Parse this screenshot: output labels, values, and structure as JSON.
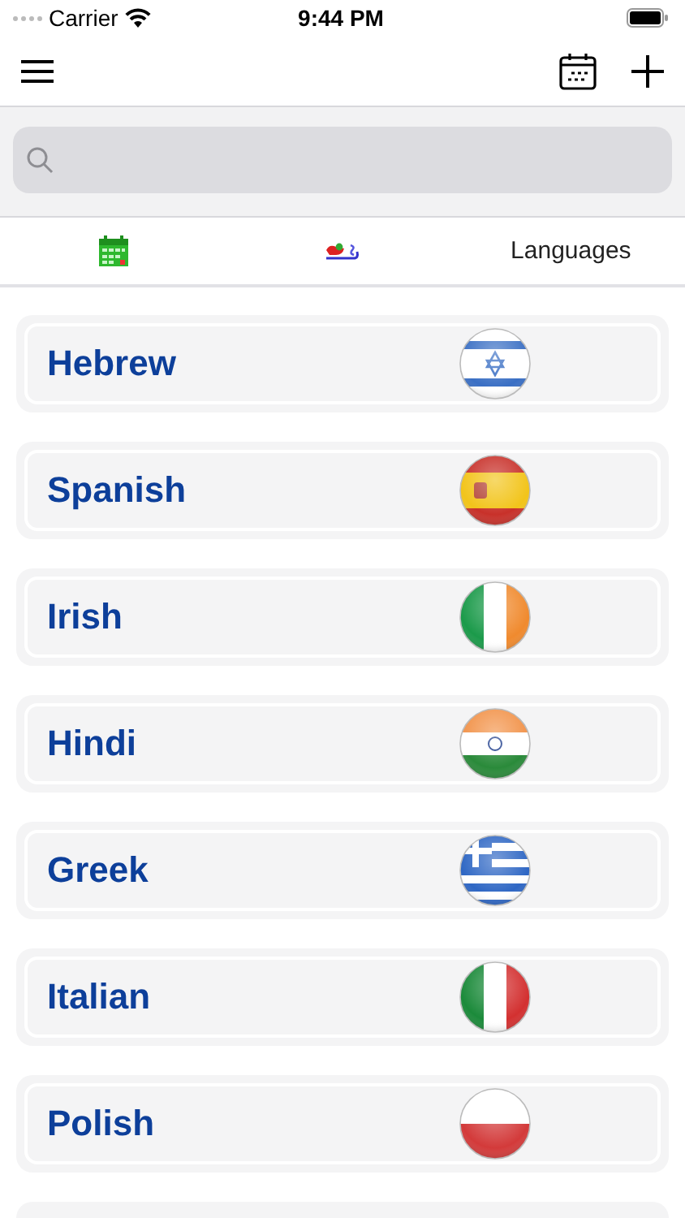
{
  "status_bar": {
    "carrier": "Carrier",
    "time": "9:44 PM"
  },
  "tabs": [
    {
      "kind": "calendar"
    },
    {
      "kind": "sleigh"
    },
    {
      "kind": "text",
      "label": "Languages"
    }
  ],
  "languages": [
    {
      "name": "Hebrew",
      "kind": "israel"
    },
    {
      "name": "Spanish",
      "kind": "spain"
    },
    {
      "name": "Irish",
      "kind": "ireland"
    },
    {
      "name": "Hindi",
      "kind": "india"
    },
    {
      "name": "Greek",
      "kind": "greece"
    },
    {
      "name": "Italian",
      "kind": "italy"
    },
    {
      "name": "Polish",
      "kind": "poland"
    }
  ]
}
